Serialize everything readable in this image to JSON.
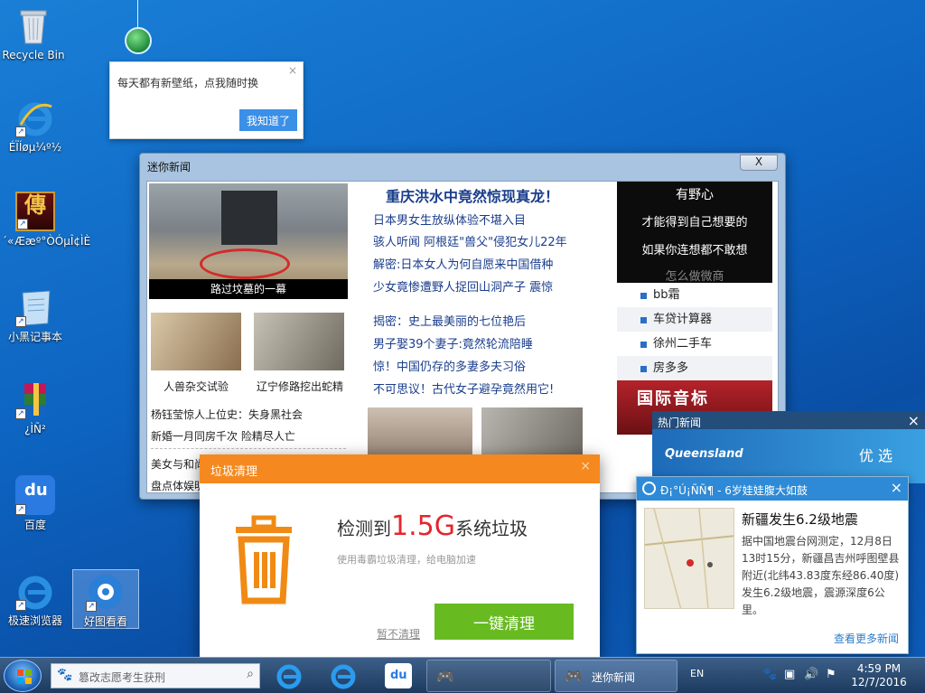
{
  "desktop": {
    "icons": [
      {
        "label": "Recycle Bin"
      },
      {
        "label": "ÉÏÍøµ¼º½"
      },
      {
        "label": "´«Ææº°ÒÓµÎ¢ÌÈ"
      },
      {
        "label": "小黑记事本"
      },
      {
        "label": "¿ÌÑ²"
      },
      {
        "label": "百度"
      },
      {
        "label": "极速浏览器"
      },
      {
        "label": "好图看看"
      }
    ]
  },
  "wallpaper_tip": {
    "text": "每天都有新壁纸，点我随时换",
    "ok_label": "我知道了",
    "close_glyph": "×"
  },
  "mini_news": {
    "title": "迷你新闻",
    "close_glyph": "X",
    "main_photo_caption": "路过坟墓的一幕",
    "thumb1_caption": "人兽杂交试验",
    "thumb2_caption": "辽宁修路挖出蛇精",
    "left_links": [
      "杨钰莹惊人上位史：失身黑社会",
      "新婚一月同房千次 险精尽人亡",
      "美女与和尚",
      "盘点体娱明"
    ],
    "headline": "重庆洪水中竟然惊现真龙！",
    "links_group1": [
      "日本男女生放纵体验不堪入目",
      "骇人听闻 阿根廷\"兽父\"侵犯女儿22年",
      "解密:日本女人为何自愿来中国借种",
      "少女竟惨遭野人捉回山洞产子 震惊"
    ],
    "links_group2": [
      "揭密：史上最美丽的七位艳后",
      "男子娶39个妻子:竟然轮流陪睡",
      "惊！中国仍存的多妻多夫习俗",
      "不可思议！古代女子避孕竟然用它!"
    ],
    "ad_dark_lines": [
      "有野心",
      "才能得到自己想要的",
      "如果你连想都不敢想",
      "怎么做微商"
    ],
    "side_list": [
      "bb霜",
      "车贷计算器",
      "徐州二手车",
      "房多多"
    ],
    "ad_red_text": "国际音标"
  },
  "junk_dialog": {
    "title": "垃圾清理",
    "close_glyph": "×",
    "main_prefix": "检测到",
    "amount": "1.5G",
    "main_suffix": "系统垃圾",
    "sub": "使用毒霸垃圾清理，给电脑加速",
    "skip_label": "暂不清理",
    "clean_label": "一键清理"
  },
  "hot_news": {
    "title": "热门新闻",
    "close_glyph": "×",
    "brand": "Queensland",
    "pick": "优 选"
  },
  "quake_notice": {
    "title": "Ð¡°Ú¡ÑÑ¶ - 6岁娃娃腹大如鼓",
    "close_glyph": "×",
    "heading": "新疆发生6.2级地震",
    "body": "据中国地震台网测定，12月8日13时15分，新疆昌吉州呼图壁县附近(北纬43.83度东经86.40度)发生6.2级地震，震源深度6公里。",
    "more": "查看更多新闻"
  },
  "taskbar": {
    "search_placeholder": "篡改志愿考生获刑",
    "active_window_label": "迷你新闻",
    "lang": "EN",
    "time": "4:59 PM",
    "date": "12/7/2016"
  }
}
